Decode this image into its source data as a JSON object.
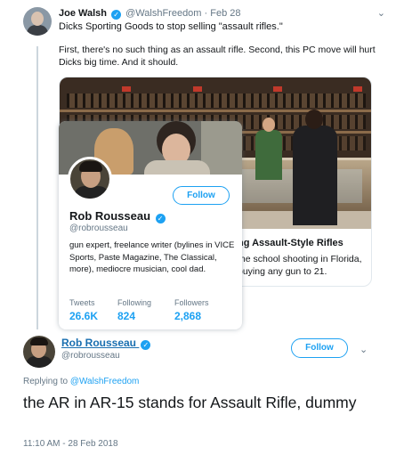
{
  "parent_tweet": {
    "author_name": "Joe Walsh",
    "author_handle": "@WalshFreedom",
    "separator": "·",
    "date": "Feb 28",
    "line1": "Dicks Sporting Goods to stop selling \"assault rifles.\"",
    "line2": "First, there's no such thing as an assault rifle. Second, this PC move will hurt Dicks big time. And it should.",
    "menu_icon": "chevron-down-icon",
    "link_card": {
      "title": "ng Assault-Style Rifles",
      "description": "the school shooting in Florida, buying any gun to 21."
    }
  },
  "hover_card": {
    "name": "Rob Rousseau",
    "handle": "@robrousseau",
    "follow_label": "Follow",
    "bio": "gun expert, freelance writer (bylines in VICE Sports, Paste Magazine, The Classical, more), mediocre musician, cool dad.",
    "stats": [
      {
        "label": "Tweets",
        "value": "26.6K"
      },
      {
        "label": "Following",
        "value": "824"
      },
      {
        "label": "Followers",
        "value": "2,868"
      }
    ]
  },
  "reply_tweet": {
    "author_name": "Rob Rousseau",
    "author_handle": "@robrousseau",
    "follow_label": "Follow",
    "replying_prefix": "Replying to",
    "replying_to": "@WalshFreedom",
    "text": "the AR in AR-15 stands for Assault Rifle, dummy",
    "timestamp": "11:10 AM - 28 Feb 2018"
  },
  "colors": {
    "accent": "#1da1f2",
    "secondary_text": "#657786",
    "border": "#e1e8ed"
  }
}
